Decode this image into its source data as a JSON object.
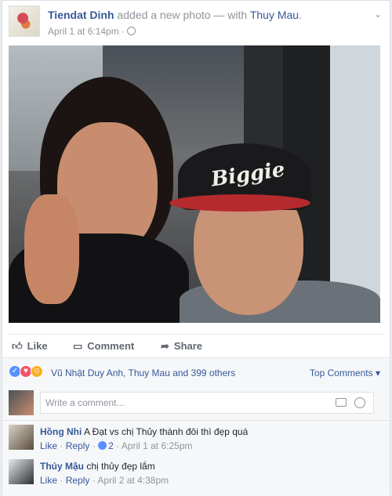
{
  "post": {
    "author": "Tiendat Dinh",
    "action": "added a new photo — with",
    "tagged": "Thuy Mau",
    "tagged_suffix": ".",
    "time": "April 1 at 6:14pm",
    "separator": "·",
    "chevron_icon": "chevron-down-icon",
    "photo_cap_text": "Biggie"
  },
  "actions": {
    "like_label": "Like",
    "comment_label": "Comment",
    "share_label": "Share",
    "like_icon": "thumbs-up-icon",
    "comment_icon": "speech-bubble-icon",
    "share_icon": "share-arrow-icon"
  },
  "reactions": {
    "summary": "Vũ Nhật Duy Anh, Thuy Mau and 399 others",
    "top_comments": "Top Comments",
    "colors": {
      "like": "#5890ff",
      "love": "#f25268",
      "haha": "#f7b125"
    }
  },
  "composer": {
    "placeholder": "Write a comment...",
    "camera_icon": "camera-icon",
    "emoji_icon": "smiley-icon"
  },
  "comments": [
    {
      "author": "Hồng Nhi",
      "text": "A Đạt vs chị Thủy thành đôi thì đẹp quá",
      "like": "Like",
      "reply": "Reply",
      "likes_count": "2",
      "time": "April 1 at 6:25pm",
      "dot": "·"
    },
    {
      "author": "Thủy Mậu",
      "text": "chị thủy đẹp lắm",
      "like": "Like",
      "reply": "Reply",
      "time": "April 2 at 4:38pm",
      "dot": "·"
    }
  ],
  "colors": {
    "link": "#365899",
    "muted": "#90949c",
    "bg": "#e9ebee"
  }
}
